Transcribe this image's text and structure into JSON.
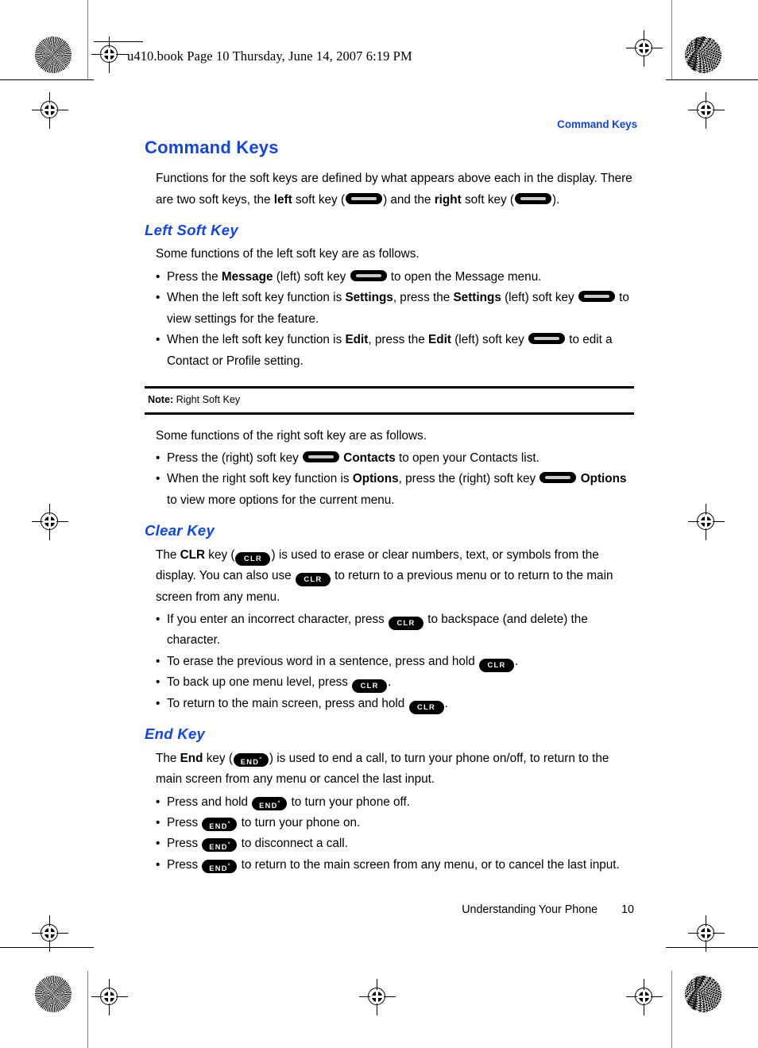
{
  "page": {
    "file_stamp": "u410.book  Page 10  Thursday, June 14, 2007  6:19 PM",
    "running_header": "Command Keys",
    "accent_color": "#1046E8",
    "footer_section": "Understanding Your Phone",
    "footer_page_number": "10"
  },
  "keys": {
    "softkey_name": "soft-key-glyph",
    "clr_label": "CLR",
    "end_label": "END",
    "end_superscript": "°"
  },
  "main": {
    "title": "Command Keys",
    "intro": {
      "p1_a": "Functions for the soft keys are defined by what appears above each in the display. There are two soft keys, the ",
      "p1_b": "left",
      "p1_c": " soft key (",
      "p1_d": ") and the ",
      "p1_e": "right",
      "p1_f": " soft key (",
      "p1_g": ")."
    },
    "sections": [
      {
        "heading": "Left Soft Key",
        "lead": "Some functions of the left soft key are as follows.",
        "bullets": [
          {
            "parts": [
              {
                "t": "Press the ",
                "b": false
              },
              {
                "t": "Message",
                "b": true
              },
              {
                "t": " (left) soft key ",
                "b": false
              },
              {
                "t": "[softkey]",
                "b": false
              },
              {
                "t": " to open the Message menu.",
                "b": false
              }
            ]
          },
          {
            "parts": [
              {
                "t": "When the left soft key function is ",
                "b": false
              },
              {
                "t": "Settings",
                "b": true
              },
              {
                "t": ", press the ",
                "b": false
              },
              {
                "t": "Settings",
                "b": true
              },
              {
                "t": " (left) soft key ",
                "b": false
              },
              {
                "t": "[softkey]",
                "b": false
              },
              {
                "t": " to view settings for the feature.",
                "b": false
              }
            ]
          },
          {
            "parts": [
              {
                "t": "When the left soft key function is ",
                "b": false
              },
              {
                "t": "Edit",
                "b": true
              },
              {
                "t": ", press the ",
                "b": false
              },
              {
                "t": "Edit",
                "b": true
              },
              {
                "t": " (left) soft key ",
                "b": false
              },
              {
                "t": "[softkey]",
                "b": false
              },
              {
                "t": " to edit a Contact or Profile setting.",
                "b": false
              }
            ]
          }
        ]
      }
    ],
    "note": {
      "label": "Note:",
      "text": " Right Soft Key"
    },
    "right_soft_key": {
      "lead": "Some functions of the right soft key are as follows.",
      "bullet1_a": "Press the (right) soft key ",
      "bullet1_b": "Contacts",
      "bullet1_c": " to open your Contacts list.",
      "bullet2_a": "When the right soft key function is ",
      "bullet2_b": "Options",
      "bullet2_c": ", press the (right) soft key ",
      "bullet2_d": "Options",
      "bullet2_e": " to view more options for the current menu."
    },
    "clear_key": {
      "heading": "Clear Key",
      "p_a": "The ",
      "p_b": "CLR",
      "p_c": " key (",
      "p_d": ") is used to erase or clear numbers, text, or symbols from the display. You can also use ",
      "p_e": " to return to a previous menu or to return to the main screen from any menu.",
      "b1_a": "If you enter an incorrect character, press ",
      "b1_b": " to backspace (and delete) the character.",
      "b2_a": "To erase the previous word in a sentence, press and hold ",
      "b2_b": ".",
      "b3_a": "To back up one menu level, press ",
      "b3_b": ".",
      "b4_a": "To return to the main screen, press and hold ",
      "b4_b": "."
    },
    "end_key": {
      "heading": "End Key",
      "p_a": "The ",
      "p_b": "End",
      "p_c": " key (",
      "p_d": ") is used to end a call, to turn your phone on/off, to return to the main screen from any menu or cancel the last input.",
      "b1_a": "Press and hold ",
      "b1_b": " to turn your phone off.",
      "b2_a": "Press ",
      "b2_b": " to turn your phone on.",
      "b3_a": "Press ",
      "b3_b": " to disconnect a call.",
      "b4_a": "Press ",
      "b4_b": " to return to the main screen from any menu, or to cancel the last input."
    }
  }
}
